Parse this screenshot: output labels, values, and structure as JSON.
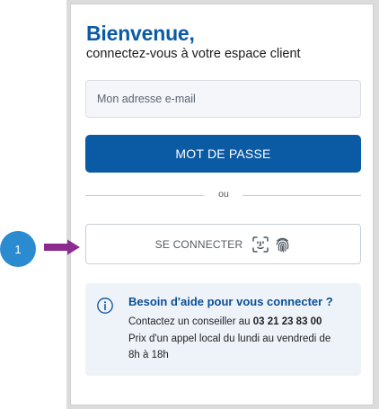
{
  "login": {
    "title": "Bienvenue,",
    "subtitle": "connectez-vous à votre espace client",
    "email_placeholder": "Mon adresse e-mail",
    "password_button": "MOT DE PASSE",
    "divider": "ou",
    "connect_button": "SE CONNECTER",
    "connect_icons": [
      "face-id-icon",
      "fingerprint-icon"
    ]
  },
  "help": {
    "icon": "info-icon",
    "title": "Besoin d'aide pour vous connecter ?",
    "contact_prefix": "Contactez un conseiller au ",
    "phone": "03 21 23 83 00",
    "hours_line1": "Prix d'un appel local du lundi au vendredi de",
    "hours_line2": "8h à 18h"
  },
  "annotation": {
    "step_number": "1",
    "badge_color": "#2a8bd1",
    "arrow_color": "#8b2a8f"
  },
  "colors": {
    "brand_blue": "#0b5aa4",
    "help_background": "#eef3fa"
  }
}
